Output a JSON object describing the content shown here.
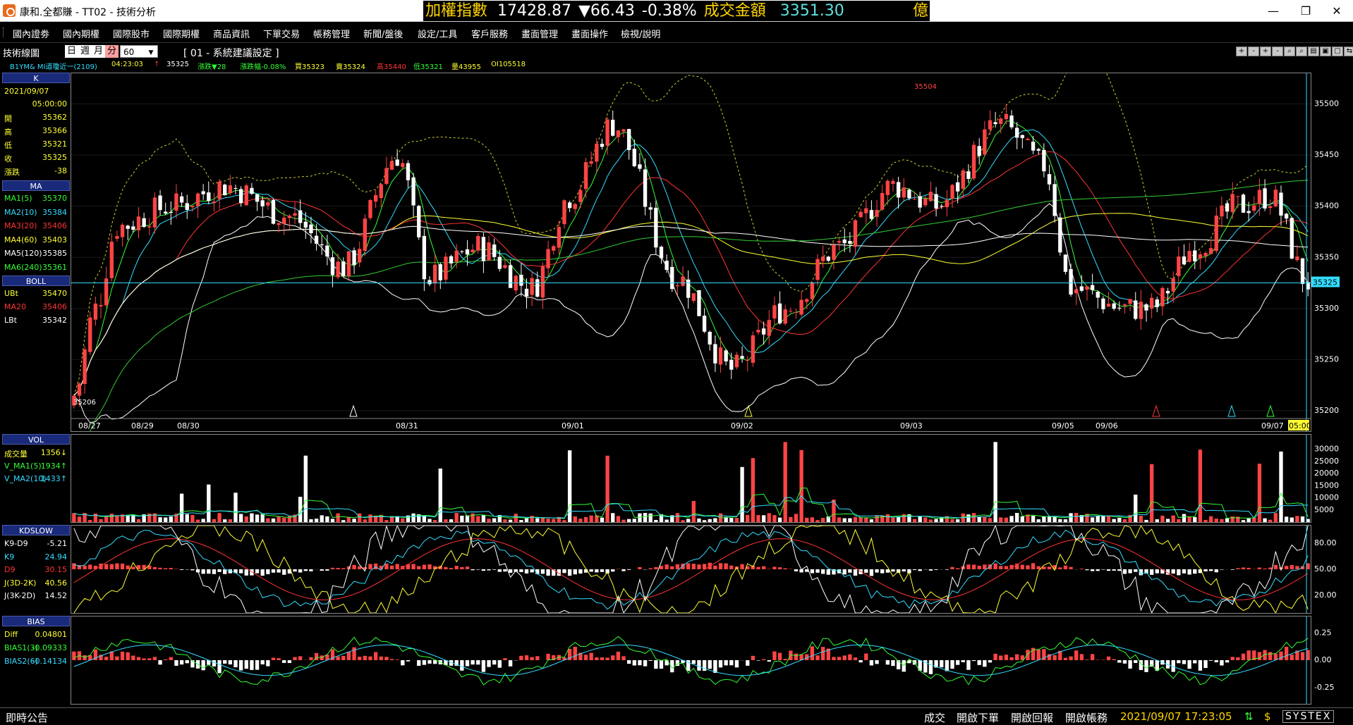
{
  "window": {
    "title": "康和.全都賺 - TT02 - 技術分析",
    "ticker": {
      "name": "加權指數",
      "value": "17428.87",
      "change": "▼66.43",
      "percent": "-0.38%",
      "turnover_label": "成交金額",
      "turnover": "3351.30",
      "unit": "億"
    },
    "controls": {
      "minimize": "—",
      "restore": "❐",
      "close": "✕"
    }
  },
  "menu": [
    "國內證劵",
    "國內期權",
    "國際股市",
    "國際期權",
    "商品資訊",
    "下單交易",
    "帳務管理",
    "新聞/盤後",
    "設定/工具",
    "客戶服務",
    "畫面管理",
    "畫面操作",
    "檢視/說明"
  ],
  "toolbar": {
    "label": "技術線圖",
    "periods": [
      "日",
      "週",
      "月",
      "分"
    ],
    "active_period": "分",
    "interval": "60",
    "setting": "[ 01 - 系統建議設定 ]",
    "buttons": [
      "+",
      "-",
      "+",
      "-",
      "⌕",
      "⌕",
      "▤",
      "▣",
      "▢",
      "⇆"
    ]
  },
  "info_row": {
    "symbol": "B1YM&  MI道瓊近一(2109)",
    "time": "04:23:03",
    "arrow": "↑",
    "price": "35325",
    "change": "漲跌▼28",
    "change_pct": "漲跌幅-0.08%",
    "buy": "買35323",
    "sell": "賣35324",
    "high": "高35440",
    "low": "低35321",
    "volume": "量43955",
    "oi": "OI105518"
  },
  "k_panel": {
    "header": "K",
    "date": "2021/09/07",
    "time": "05:00:00",
    "rows": [
      {
        "label": "開",
        "value": "35362"
      },
      {
        "label": "高",
        "value": "35366"
      },
      {
        "label": "低",
        "value": "35321"
      },
      {
        "label": "收",
        "value": "35325"
      },
      {
        "label": "漲跌",
        "value": "-38"
      }
    ]
  },
  "ma_panel": {
    "header": "MA",
    "rows": [
      {
        "label": "MA1(5)",
        "value": "35370",
        "color": "#33ff33"
      },
      {
        "label": "MA2(10)",
        "value": "35384",
        "color": "#33ddff"
      },
      {
        "label": "MA3(20)",
        "value": "35406",
        "color": "#ff3333"
      },
      {
        "label": "MA4(60)",
        "value": "35403",
        "color": "#ffff33"
      },
      {
        "label": "MA5(120)",
        "value": "35385",
        "color": "#ffffff"
      },
      {
        "label": "MA6(240)",
        "value": "35361",
        "color": "#33ff33"
      }
    ]
  },
  "boll_panel": {
    "header": "BOLL",
    "rows": [
      {
        "label": "UBt",
        "value": "35470",
        "color": "#ffff33"
      },
      {
        "label": "MA20",
        "value": "35406",
        "color": "#ff3333"
      },
      {
        "label": "LBt",
        "value": "35342",
        "color": "#ffffff"
      }
    ]
  },
  "price_chart": {
    "y_ticks": [
      "35500",
      "35450",
      "35400",
      "35350",
      "35300",
      "35250",
      "35200"
    ],
    "current_price": "35325",
    "high_label": "35504",
    "low_label": "35206",
    "x_labels": [
      "08/27",
      "08/29",
      "08/30",
      "08/31",
      "09/01",
      "09/02",
      "09/03",
      "09/05",
      "09/06",
      "09/07"
    ],
    "last_time": "05:00"
  },
  "vol_panel": {
    "header": "VOL",
    "rows": [
      {
        "label": "成交量",
        "value": "1356↓",
        "color": "#ffff33"
      },
      {
        "label": "V_MA1(5)",
        "value": "1934↑",
        "color": "#33ff33"
      },
      {
        "label": "V_MA2(10)",
        "value": "1433↑",
        "color": "#33ddff"
      }
    ],
    "y_ticks": [
      "30000",
      "25000",
      "20000",
      "15000",
      "10000",
      "5000"
    ]
  },
  "kd_panel": {
    "header": "KDSLOW",
    "rows": [
      {
        "label": "K9-D9",
        "value": "-5.21",
        "color": "#ffffff"
      },
      {
        "label": "K9",
        "value": "24.94",
        "color": "#33ddff"
      },
      {
        "label": "D9",
        "value": "30.15",
        "color": "#ff3333"
      },
      {
        "label": "J(3D-2K)",
        "value": "40.56",
        "color": "#ffff33"
      },
      {
        "label": "J(3K-2D)",
        "value": "14.52",
        "color": "#ffffff"
      }
    ],
    "y_ticks": [
      "80.00",
      "50.00",
      "20.00"
    ]
  },
  "bias_panel": {
    "header": "BIAS",
    "rows": [
      {
        "label": "Diff",
        "value": "0.04801",
        "color": "#ffff33"
      },
      {
        "label": "BIAS1(3)",
        "value": "-0.09333",
        "color": "#33ff33"
      },
      {
        "label": "BIAS2(6)",
        "value": "-0.14134",
        "color": "#33ddff"
      }
    ],
    "y_ticks": [
      "0.25",
      "0.00",
      "-0.25"
    ]
  },
  "status": {
    "ticker": "即時公告",
    "buttons": [
      "成交",
      "開啟下單",
      "開啟回報",
      "開啟帳務"
    ],
    "time": "2021/09/07 17:23:05",
    "logo": "SYSTEX"
  }
}
